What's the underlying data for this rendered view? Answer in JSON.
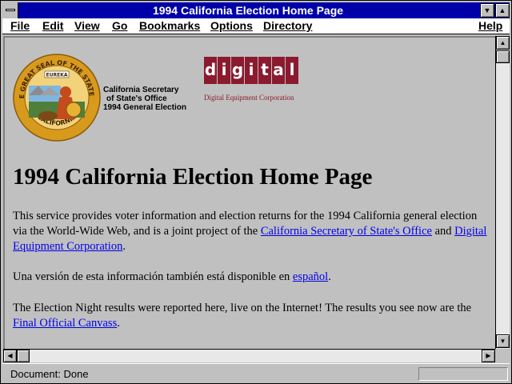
{
  "window": {
    "title": "1994 California Election Home Page"
  },
  "menu": [
    {
      "label": "File",
      "name": "menu-file"
    },
    {
      "label": "Edit",
      "name": "menu-edit"
    },
    {
      "label": "View",
      "name": "menu-view"
    },
    {
      "label": "Go",
      "name": "menu-go"
    },
    {
      "label": "Bookmarks",
      "name": "menu-bookmarks"
    },
    {
      "label": "Options",
      "name": "menu-options"
    },
    {
      "label": "Directory",
      "name": "menu-directory"
    },
    {
      "label": "Help",
      "name": "menu-help"
    }
  ],
  "header": {
    "seal_text_top": "THE GREAT SEAL OF THE STATE OF",
    "seal_text_bottom": "CALIFORNIA",
    "seal_motto": "EUREKA",
    "sos_line1": "California Secretary",
    "sos_line2": "of State's Office",
    "sos_line3": "1994 General Election",
    "dec_letters": [
      "d",
      "i",
      "g",
      "i",
      "t",
      "a",
      "l"
    ],
    "dec_caption": "Digital Equipment Corporation"
  },
  "page": {
    "heading": "1994 California Election Home Page",
    "p1_text_a": "This service provides voter information and election returns for the 1994 California general election via the World-Wide Web, and is a joint project of the ",
    "p1_link1": "California Secretary of State's Office",
    "p1_text_b": " and ",
    "p1_link2": "Digital Equipment Corporation",
    "p1_text_c": ".",
    "p2_text_a": "Una versión de esta información también está disponible en ",
    "p2_link": "español",
    "p2_text_b": ".",
    "p3_text_a": "The Election Night results were reported here, live on the Internet! The results you see now are the ",
    "p3_link": "Final Official Canvass",
    "p3_text_b": "."
  },
  "status": {
    "text": "Document: Done"
  },
  "colors": {
    "titlebar": "#0000a8",
    "link": "#0000ee",
    "dec_red": "#8b1a2f",
    "seal_gold": "#d89a1c"
  }
}
